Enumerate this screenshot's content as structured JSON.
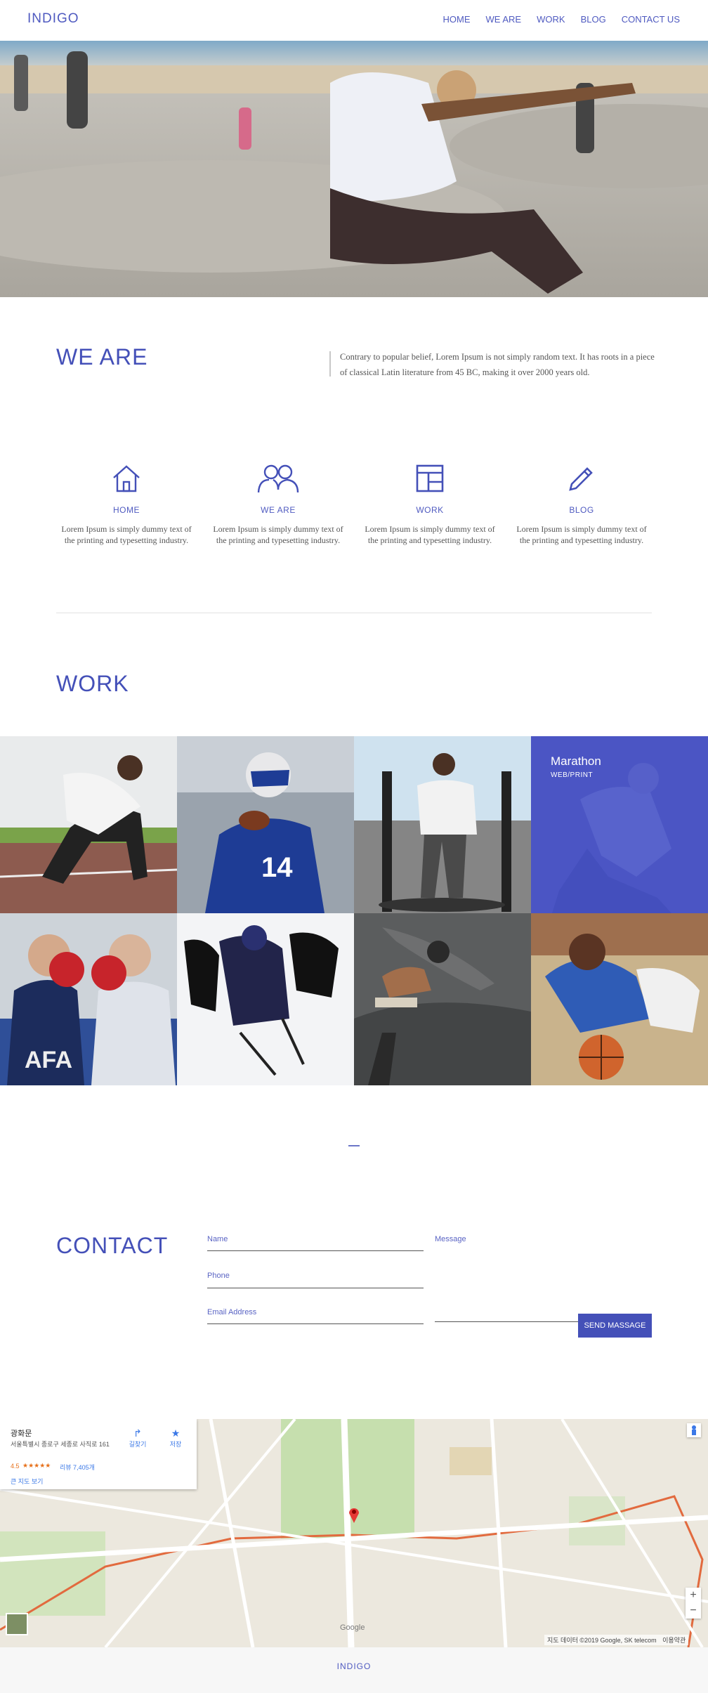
{
  "brand": "INDIGO",
  "nav": [
    "HOME",
    "WE ARE",
    "WORK",
    "BLOG",
    "CONTACT US"
  ],
  "about": {
    "title": "WE ARE",
    "text": "Contrary to popular belief, Lorem Ipsum is not simply random text. It has roots in a piece of classical Latin literature from 45 BC, making it over 2000 years old."
  },
  "features": [
    {
      "icon": "home-icon",
      "label": "HOME",
      "desc": "Lorem Ipsum is simply dummy text of the printing and typesetting industry."
    },
    {
      "icon": "people-icon",
      "label": "WE ARE",
      "desc": "Lorem Ipsum is simply dummy text of the printing and typesetting industry."
    },
    {
      "icon": "layout-icon",
      "label": "WORK",
      "desc": "Lorem Ipsum is simply dummy text of the printing and typesetting industry."
    },
    {
      "icon": "pencil-icon",
      "label": "BLOG",
      "desc": "Lorem Ipsum is simply dummy text of the printing and typesetting industry."
    }
  ],
  "work": {
    "title": "WORK",
    "highlight_title": "Marathon",
    "highlight_sub": "WEB/PRINT"
  },
  "contact": {
    "title": "CONTACT",
    "name_label": "Name",
    "phone_label": "Phone",
    "email_label": "Email Address",
    "message_label": "Message",
    "button": "SEND MASSAGE"
  },
  "map": {
    "place": "광화문",
    "address": "서울특별시 종로구 세종로 사직로 161",
    "rating": "4.5",
    "stars": "★★★★★",
    "reviews": "리뷰 7,405개",
    "directions": "길찾기",
    "save": "저장",
    "larger": "큰 지도 보기",
    "credit": "지도 데이터 ©2019 Google, SK telecom",
    "terms": "이용약관",
    "zoom_in": "+",
    "zoom_out": "−",
    "google": "Google"
  },
  "colors": {
    "accent": "#4450b8",
    "overlay": "#4b55c4"
  }
}
